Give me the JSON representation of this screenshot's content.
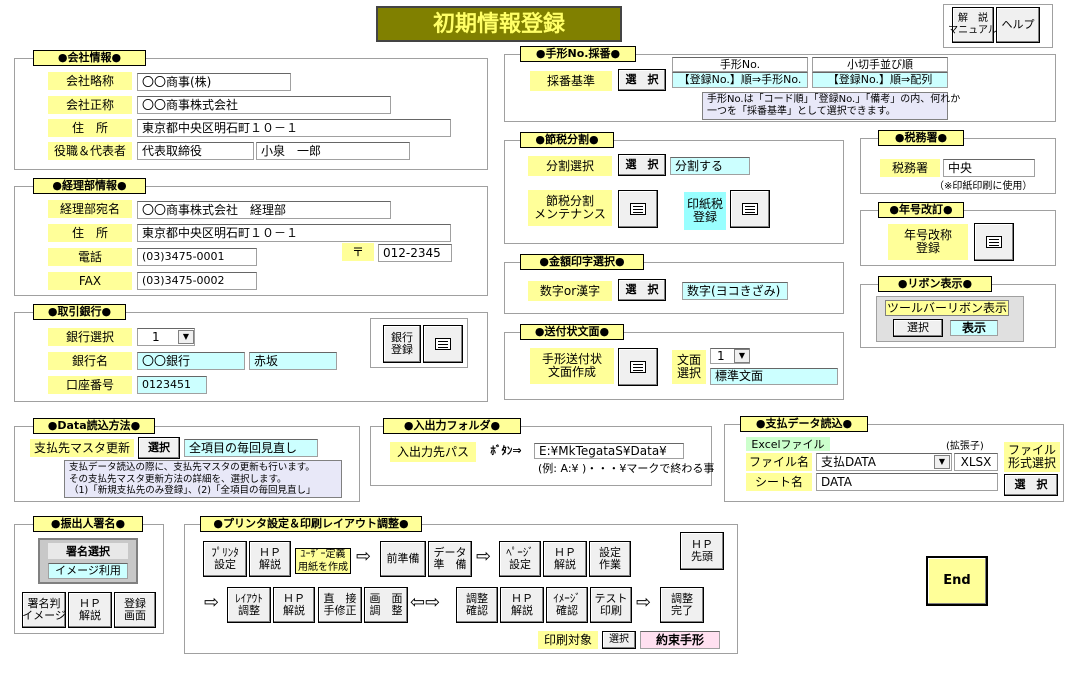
{
  "title": "初期情報登録",
  "top": {
    "manual": "解　説\nマニュアル",
    "help": "ヘルプ"
  },
  "company": {
    "group": "●会社情報●",
    "abbr_label": "会社略称",
    "abbr": "〇〇商事(株)",
    "name_label": "会社正称",
    "name": "〇〇商事株式会社",
    "addr_label": "住　所",
    "addr": "東京都中央区明石町１０－１",
    "rep_label": "役職＆代表者",
    "title": "代表取締役",
    "rep": "小泉　一郎"
  },
  "acct": {
    "group": "●経理部情報●",
    "dept_label": "経理部宛名",
    "dept": "〇〇商事株式会社　経理部",
    "addr_label": "住　所",
    "addr": "東京都中央区明石町１０－１",
    "tel_label": "電話",
    "tel": "(03)3475-0001",
    "zip_mark": "〒",
    "zip": "012-2345",
    "fax_label": "FAX",
    "fax": "(03)3475-0002"
  },
  "bank": {
    "group": "●取引銀行●",
    "sel_label": "銀行選択",
    "sel": "1",
    "name_label": "銀行名",
    "name": "〇〇銀行",
    "branch": "赤坂",
    "acct_label": "口座番号",
    "acct": "0123451",
    "reg": "銀行\n登録"
  },
  "tegata": {
    "group": "●手形No.採番●",
    "label": "採番基準",
    "select": "選　択",
    "h1": "手形No.",
    "h2": "小切手並び順",
    "v1": "【登録No.】順⇒手形No.",
    "v2": "【登録No.】順⇒配列",
    "note": "手形No.は「コード順」「登録No.」「備考」の内、何れか\n一つを「採番基準」として選択できます。"
  },
  "split": {
    "group": "●節税分割●",
    "label": "分割選択",
    "select": "選　択",
    "value": "分割する",
    "maint": "節税分割\nメンテナンス",
    "stamp": "印紙税\n登録"
  },
  "tax": {
    "group": "●税務署●",
    "label": "税務署",
    "value": "中央",
    "note": "（※印紙印刷に使用）"
  },
  "era": {
    "group": "●年号改訂●",
    "label": "年号改称\n登録"
  },
  "amount": {
    "group": "●金額印字選択●",
    "label": "数字or漢字",
    "select": "選　択",
    "value": "数字(ヨコきざみ)"
  },
  "ribbon": {
    "group": "●リボン表示●",
    "label": "ツールバーリボン表示",
    "select": "選択",
    "value": "表示"
  },
  "letter": {
    "group": "●送付状文面●",
    "create": "手形送付状\n文面作成",
    "sel_label": "文面\n選択",
    "sel": "1",
    "value": "標準文面"
  },
  "data": {
    "group": "●Data読込方法●",
    "label": "支払先マスタ更新",
    "select": "選択",
    "value": "全項目の毎回見直し",
    "note": "支払データ読込の際に、支払先マスタの更新も行います。\nその支払先マスタ更新方法の詳細を、選択します。\n（1)「新規支払先のみ登録」、(2)「全項目の毎回見直し」"
  },
  "io": {
    "group": "●入出力フォルダ●",
    "label": "入出力先パス",
    "btn": "ﾎﾞﾀﾝ⇒",
    "value": "E:¥MkTegataS¥Data¥",
    "example": "(例: A:¥ )・・・¥マークで終わる事"
  },
  "pay": {
    "group": "●支払データ読込●",
    "excel": "Excelファイル",
    "ext_label": "(拡張子)",
    "file_label": "ファイル名",
    "file": "支払DATA",
    "ext": "XLSX",
    "sheet_label": "シート名",
    "sheet": "DATA",
    "format": "ファイル\n形式選択",
    "select": "選　択"
  },
  "sign": {
    "group": "●振出人署名●",
    "select": "署名選択",
    "value": "イメージ利用",
    "img": "署名判\nイメージ",
    "hp": "ＨＰ\n解説",
    "reg": "登録\n画面"
  },
  "print": {
    "group": "●プリンタ設定＆印刷レイアウト調整●",
    "b1": "ﾌﾟﾘﾝﾀ\n設定",
    "b2": "ＨＰ\n解説",
    "b3": "ﾕｰｻﾞｰ定義\n用紙を作成",
    "b4": "前準備",
    "b5": "データ\n準　備",
    "b6": "ﾍﾟｰｼﾞ\n設定",
    "b7": "ＨＰ\n解説",
    "b8": "設定\n作業",
    "r1": "ﾚｲｱｳﾄ\n調整",
    "r2": "ＨＰ\n解説",
    "r3": "直　接\n手修正",
    "r4": "画　面\n調　整",
    "r5": "調整\n確認",
    "r6": "ＨＰ\n解説",
    "r7": "ｲﾒｰｼﾞ\n確認",
    "r8": "テスト\n印刷",
    "r9": "調整\n完了",
    "target_label": "印刷対象",
    "target_sel": "選択",
    "target": "約束手形",
    "hp_top": "ＨＰ\n先頭"
  },
  "end": "End"
}
